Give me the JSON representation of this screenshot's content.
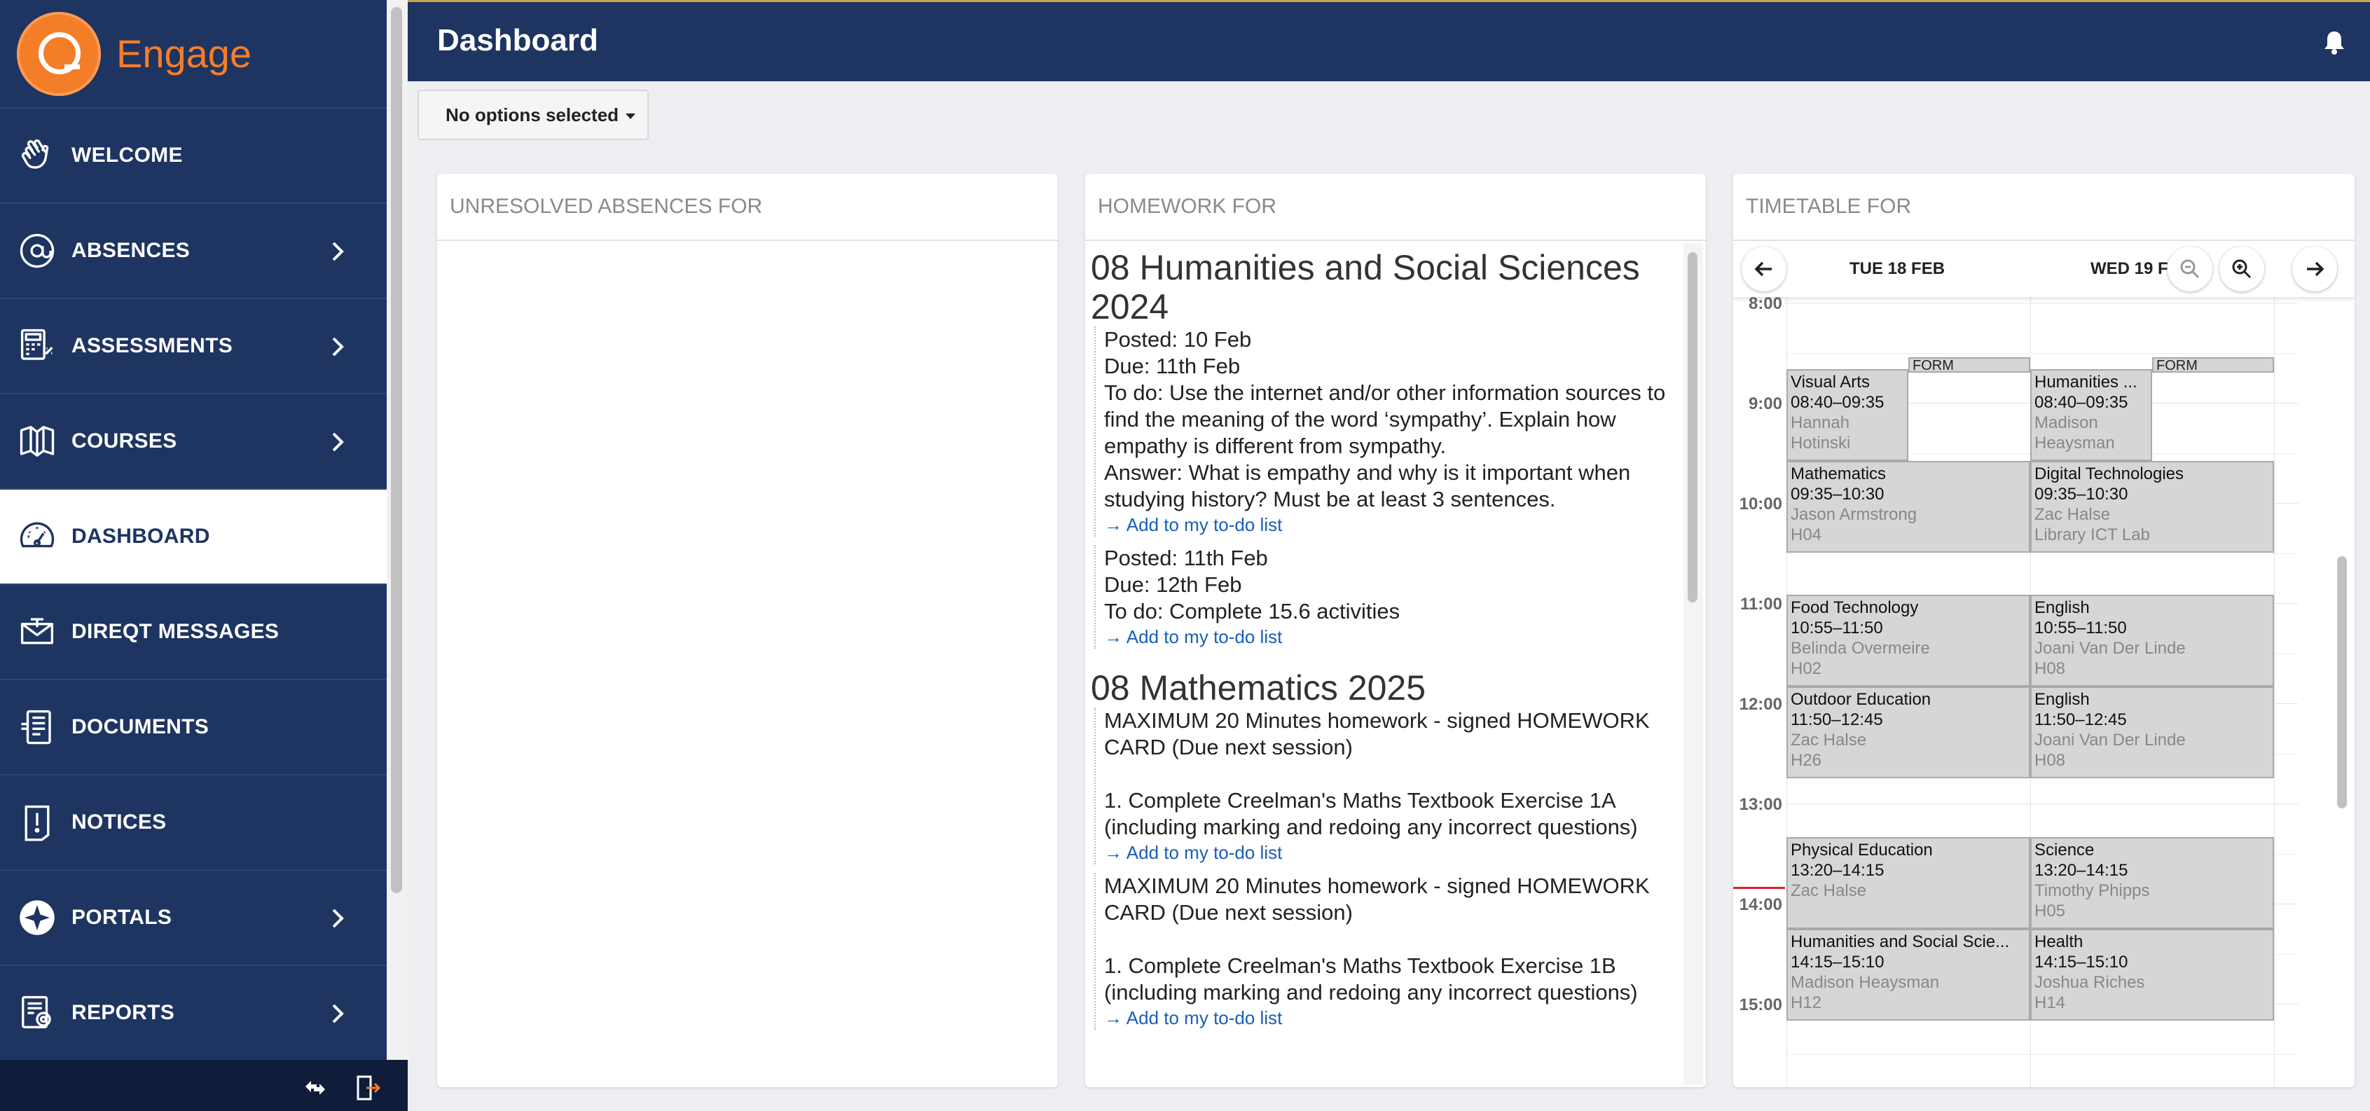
{
  "app": {
    "name": "Engage"
  },
  "sidebar": {
    "items": [
      {
        "label": "WELCOME",
        "icon": "hand-wave-icon",
        "chevron": false
      },
      {
        "label": "ABSENCES",
        "icon": "at-sign-icon",
        "chevron": true
      },
      {
        "label": "ASSESSMENTS",
        "icon": "calculator-percent-icon",
        "chevron": true
      },
      {
        "label": "COURSES",
        "icon": "open-book-icon",
        "chevron": true
      },
      {
        "label": "DASHBOARD",
        "icon": "speedometer-icon",
        "chevron": false,
        "active": true
      },
      {
        "label": "DIREQT MESSAGES",
        "icon": "envelope-icon",
        "chevron": false
      },
      {
        "label": "DOCUMENTS",
        "icon": "document-list-icon",
        "chevron": false
      },
      {
        "label": "NOTICES",
        "icon": "exclamation-notice-icon",
        "chevron": false
      },
      {
        "label": "PORTALS",
        "icon": "aperture-icon",
        "chevron": true
      },
      {
        "label": "REPORTS",
        "icon": "report-certificate-icon",
        "chevron": true
      }
    ]
  },
  "header": {
    "title": "Dashboard"
  },
  "filter": {
    "label": "No options selected"
  },
  "panels": {
    "absences_title": "UNRESOLVED ABSENCES FOR",
    "homework_title": "HOMEWORK FOR",
    "timetable_title": "TIMETABLE FOR"
  },
  "homework": {
    "link_label": "→ Add to my to-do list",
    "courses": [
      {
        "name": "08 Humanities and Social Sciences 2024",
        "items": [
          {
            "lines": [
              "Posted: 10 Feb",
              "Due: 11th Feb",
              "To do: Use the internet and/or other information sources to find the meaning of the word ‘sympathy’. Explain how empathy is different from sympathy.",
              "Answer: What is empathy and why is it important when studying history? Must be at least 3 sentences."
            ]
          },
          {
            "lines": [
              "Posted: 11th Feb",
              "Due: 12th Feb",
              "To do: Complete 15.6 activities"
            ]
          }
        ]
      },
      {
        "name": "08 Mathematics 2025",
        "items": [
          {
            "lines": [
              "MAXIMUM 20 Minutes homework - signed HOMEWORK CARD (Due next session)",
              "",
              "1. Complete  Creelman's Maths Textbook  Exercise 1A (including marking and redoing any incorrect questions)"
            ]
          },
          {
            "lines": [
              "MAXIMUM 20 Minutes homework - signed HOMEWORK CARD (Due next session)",
              "",
              "1. Complete  Creelman's Maths Textbook  Exercise 1B (including marking and redoing any incorrect questions)"
            ]
          }
        ]
      }
    ]
  },
  "timetable": {
    "days": [
      "TUE 18 FEB",
      "WED 19 FEB"
    ],
    "times": [
      "8:00",
      "9:00",
      "10:00",
      "11:00",
      "12:00",
      "13:00",
      "14:00",
      "15:00"
    ],
    "form_label": "FORM",
    "events": [
      {
        "day": 0,
        "name": "Visual Arts",
        "time": "08:40–09:35",
        "teacher": "Hannah Hotinski",
        "teacher_l1": "Hannah",
        "teacher_l2": "Hotinski",
        "room": ""
      },
      {
        "day": 0,
        "name": "Mathematics",
        "time": "09:35–10:30",
        "teacher": "Jason Armstrong",
        "room": "H04"
      },
      {
        "day": 0,
        "name": "Food Technology",
        "time": "10:55–11:50",
        "teacher": "Belinda Overmeire",
        "room": "H02"
      },
      {
        "day": 0,
        "name": "Outdoor Education",
        "time": "11:50–12:45",
        "teacher": "Zac Halse",
        "room": "H26"
      },
      {
        "day": 0,
        "name": "Physical Education",
        "time": "13:20–14:15",
        "teacher": "Zac Halse",
        "room": ""
      },
      {
        "day": 0,
        "name": "Humanities and Social Scie...",
        "time": "14:15–15:10",
        "teacher": "Madison Heaysman",
        "room": "H12"
      },
      {
        "day": 1,
        "name": "Humanities ...",
        "time": "08:40–09:35",
        "teacher": "Madison Heaysman",
        "teacher_l1": "Madison",
        "teacher_l2": "Heaysman",
        "room": ""
      },
      {
        "day": 1,
        "name": "Digital Technologies",
        "time": "09:35–10:30",
        "teacher": "Zac Halse",
        "room": "Library ICT Lab"
      },
      {
        "day": 1,
        "name": "English",
        "time": "10:55–11:50",
        "teacher": "Joani Van Der Linde",
        "room": "H08"
      },
      {
        "day": 1,
        "name": "English",
        "time": "11:50–12:45",
        "teacher": "Joani Van Der Linde",
        "room": "H08"
      },
      {
        "day": 1,
        "name": "Science",
        "time": "13:20–14:15",
        "teacher": "Timothy Phipps",
        "room": "H05"
      },
      {
        "day": 1,
        "name": "Health",
        "time": "14:15–15:10",
        "teacher": "Joshua Riches",
        "room": "H14"
      }
    ]
  }
}
